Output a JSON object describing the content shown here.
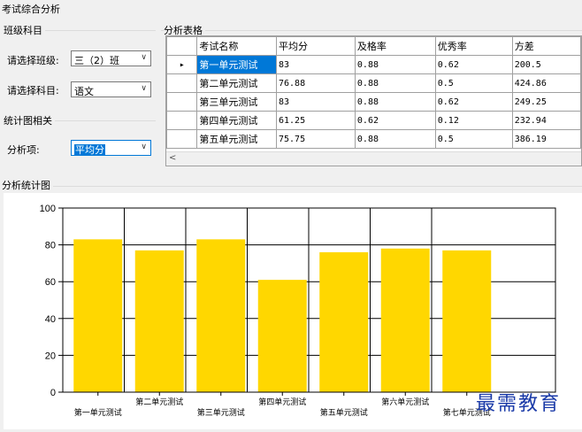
{
  "window": {
    "title": "考试综合分析"
  },
  "class_subject": {
    "title": "班级科目",
    "class_label": "请选择班级:",
    "class_value": "三（2）班",
    "subject_label": "请选择科目:",
    "subject_value": "语文"
  },
  "stats_group": {
    "title": "统计图相关",
    "item_label": "分析项:",
    "item_value": "平均分"
  },
  "table_group": {
    "title": "分析表格",
    "columns": [
      "考试名称",
      "平均分",
      "及格率",
      "优秀率",
      "方差"
    ],
    "rows": [
      [
        "第一单元测试",
        "83",
        "0.88",
        "0.62",
        "200.5"
      ],
      [
        "第二单元测试",
        "76.88",
        "0.88",
        "0.5",
        "424.86"
      ],
      [
        "第三单元测试",
        "83",
        "0.88",
        "0.62",
        "249.25"
      ],
      [
        "第四单元测试",
        "61.25",
        "0.62",
        "0.12",
        "232.94"
      ],
      [
        "第五单元测试",
        "75.75",
        "0.88",
        "0.5",
        "386.19"
      ]
    ],
    "row_indicator": "▸",
    "scroll_left": "<"
  },
  "chart_group": {
    "title": "分析统计图"
  },
  "chart_data": {
    "type": "bar",
    "categories": [
      "第一单元测试",
      "第二单元测试",
      "第三单元测试",
      "第四单元测试",
      "第五单元测试",
      "第六单元测试",
      "第七单元测试"
    ],
    "values": [
      83,
      77,
      83,
      61,
      76,
      78,
      77
    ],
    "ylim": [
      0,
      100
    ],
    "yticks": [
      "0",
      "20",
      "40",
      "60",
      "80",
      "100"
    ],
    "grid": true,
    "bar_color": "#ffd700",
    "title": "",
    "xlabel": "",
    "ylabel": ""
  },
  "watermark": "最需教育"
}
